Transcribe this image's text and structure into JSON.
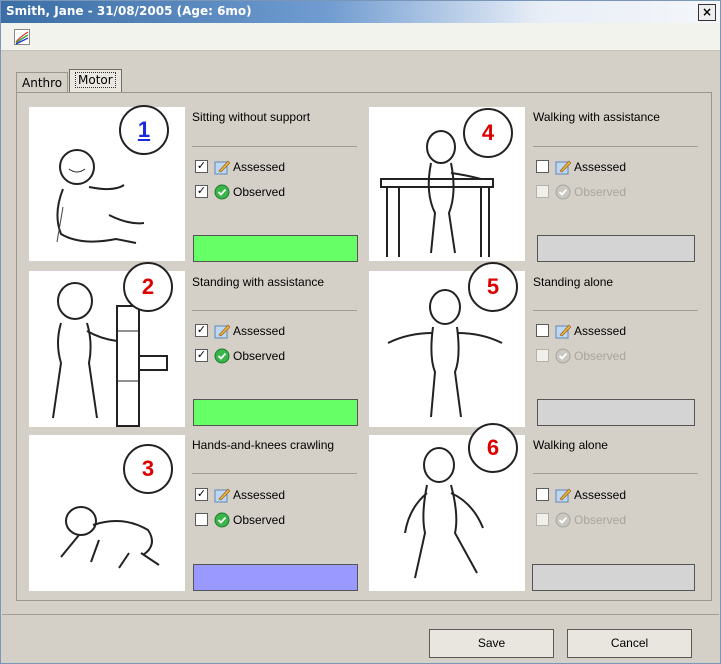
{
  "window": {
    "title": "Smith, Jane - 31/08/2005 (Age: 6mo)",
    "close_label": "×"
  },
  "toolbar": {
    "icon": "chart-icon"
  },
  "tabs": [
    {
      "label": "Anthro"
    },
    {
      "label": "Motor"
    }
  ],
  "milestones": [
    {
      "number": "1",
      "label": "Sitting without support",
      "assessed": "Assessed",
      "observed": "Observed",
      "assessed_checked": true,
      "observed_checked": true,
      "observed_enabled": true,
      "status_color": "#66ff66"
    },
    {
      "number": "2",
      "label": "Standing with assistance",
      "assessed": "Assessed",
      "observed": "Observed",
      "assessed_checked": true,
      "observed_checked": true,
      "observed_enabled": true,
      "status_color": "#66ff66"
    },
    {
      "number": "3",
      "label": "Hands-and-knees crawling",
      "assessed": "Assessed",
      "observed": "Observed",
      "assessed_checked": true,
      "observed_checked": false,
      "observed_enabled": true,
      "status_color": "#9999ff"
    },
    {
      "number": "4",
      "label": "Walking with assistance",
      "assessed": "Assessed",
      "observed": "Observed",
      "assessed_checked": false,
      "observed_checked": false,
      "observed_enabled": false,
      "status_color": "#d4d4d4"
    },
    {
      "number": "5",
      "label": "Standing alone",
      "assessed": "Assessed",
      "observed": "Observed",
      "assessed_checked": false,
      "observed_checked": false,
      "observed_enabled": false,
      "status_color": "#d4d4d4"
    },
    {
      "number": "6",
      "label": "Walking alone",
      "assessed": "Assessed",
      "observed": "Observed",
      "assessed_checked": false,
      "observed_checked": false,
      "observed_enabled": false,
      "status_color": "#d4d4d4"
    }
  ],
  "buttons": {
    "save": "Save",
    "cancel": "Cancel"
  },
  "colors": {
    "met": "#66ff66",
    "assessed_not_observed": "#9999ff",
    "not_assessed": "#d4d4d4",
    "number_red": "#dd0000",
    "number_blue": "#1b2ae0"
  }
}
